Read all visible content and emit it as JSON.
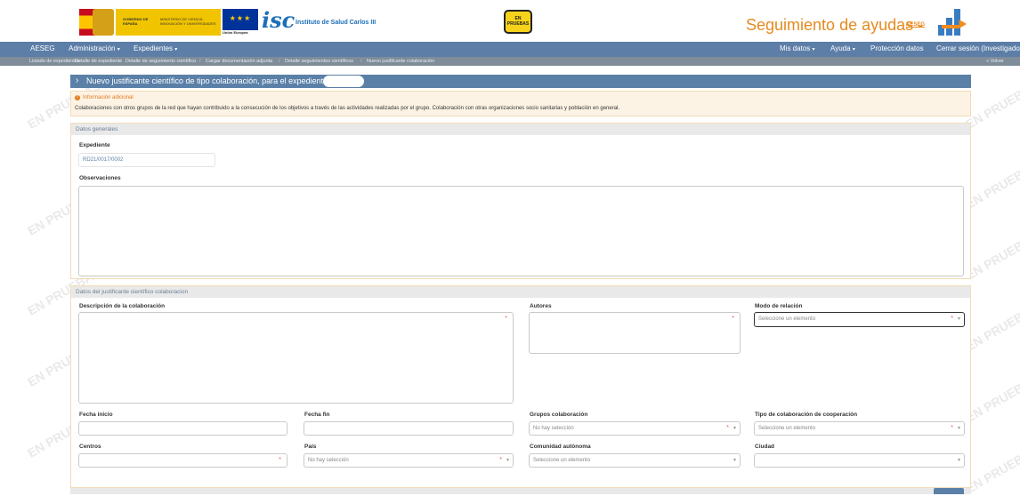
{
  "watermark_text": "EN PRUEBAS",
  "header": {
    "gov_line1": "GOBIERNO DE ESPAÑA",
    "gov_line2": "MINISTERIO DE CIENCIA, INNOVACIÓN Y UNIVERSIDADES",
    "eu_label": "Unión Europea",
    "isc_mark": "isc",
    "isc_label": "Instituto de Salud Carlos III",
    "badge": "EN PRUEBAS",
    "brand_title": "Seguimiento de ayudas -",
    "brand_sub": "AESEG"
  },
  "navbar": {
    "brand": "AESEG",
    "menu_admin": "Administración",
    "menu_exp": "Expedientes",
    "mis_datos": "Mis datos",
    "ayuda": "Ayuda",
    "proteccion": "Protección datos",
    "cerrar": "Cerrar sesión (Investigador)",
    "caret": "▾"
  },
  "breadcrumb": {
    "items": [
      "Listado de expedientes",
      "Detalle de expediente",
      "Detalle de seguimiento científico",
      "Cargar documentación adjunta",
      "Detalle seguimientos científicos",
      "Nuevo justificante colaboración"
    ],
    "back": "« Volver"
  },
  "page": {
    "title": "Nuevo justificante científico de tipo colaboración, para el expediente: RD2"
  },
  "info": {
    "heading": "Información adicional",
    "body": "Colaboraciones con otros grupos de la red que hayan contribuido a la consecución de los objetivos a través de las actividades realizadas por el grupo. Colaboración con otras organizaciones socio sanitarias y población en general."
  },
  "general": {
    "section_title": "Datos generales",
    "expediente_label": "Expediente",
    "expediente_value": "RD21/0017/0002",
    "observaciones_label": "Observaciones"
  },
  "justificante": {
    "section_title": "Datos del justificante científico colaboracion",
    "descripcion_label": "Descripción de la colaboración",
    "autores_label": "Autores",
    "modo_label": "Modo de relación",
    "modo_placeholder": "Seleccione un elemento",
    "fecha_inicio_label": "Fecha inicio",
    "fecha_fin_label": "Fecha fin",
    "grupos_label": "Grupos colaboración",
    "grupos_placeholder": "No hay selección",
    "tipo_label": "Tipo de colaboración de cooperación",
    "tipo_placeholder": "Seleccione un elemento",
    "centros_label": "Centros",
    "pais_label": "País",
    "pais_placeholder": "No hay selección",
    "comunidad_label": "Comunidad autónoma",
    "comunidad_placeholder": "Seleccione un elemento",
    "ciudad_label": "Ciudad"
  },
  "symbols": {
    "required": "*",
    "arrow": "▾",
    "chevron": "›",
    "info": "!"
  },
  "colors": {
    "navbar": "#5c7ea7",
    "breadcrumb": "#7f8d9a",
    "accent_orange": "#e58a1f",
    "title_bar": "#5a80a8",
    "info_bg": "#fdf3e5"
  }
}
